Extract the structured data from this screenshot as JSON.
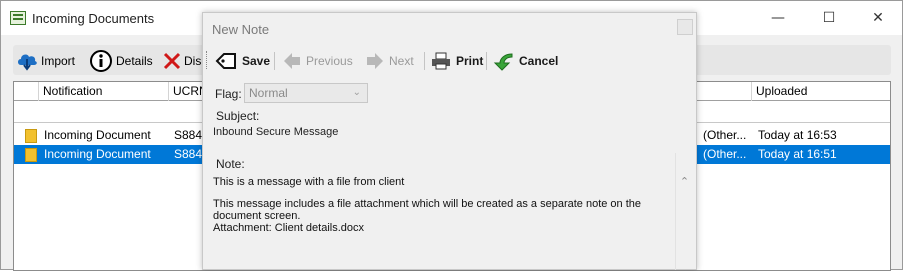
{
  "window": {
    "title": "Incoming Documents",
    "minimize": "—",
    "maximize": "☐",
    "close": "✕"
  },
  "toolbar": {
    "import_label": "Import",
    "details_label": "Details",
    "dismiss_label": "Dis"
  },
  "grid": {
    "headers": {
      "notification": "Notification",
      "ucrn": "UCRN",
      "uploaded": "Uploaded"
    },
    "rows": [
      {
        "notification": "Incoming Document",
        "ucrn": "S884/",
        "other": "(Other...",
        "uploaded": "Today at 16:53",
        "selected": false
      },
      {
        "notification": "Incoming Document",
        "ucrn": "S884/",
        "other": "(Other...",
        "uploaded": "Today at 16:51",
        "selected": true
      }
    ]
  },
  "dialog": {
    "title": "New Note",
    "toolbar": {
      "save": "Save",
      "previous": "Previous",
      "next": "Next",
      "print": "Print",
      "cancel": "Cancel"
    },
    "flag_label": "Flag:",
    "flag_value": "Normal",
    "subject_label": "Subject:",
    "subject_value": "Inbound Secure Message",
    "note_label": "Note:",
    "note_lines": [
      "This is a message with a file from client",
      "This message includes a file attachment which will be created as a separate note on the",
      "document screen.",
      "Attachment: Client details.docx"
    ]
  },
  "colors": {
    "selection": "#0078d7",
    "folder": "#f2c12e"
  }
}
